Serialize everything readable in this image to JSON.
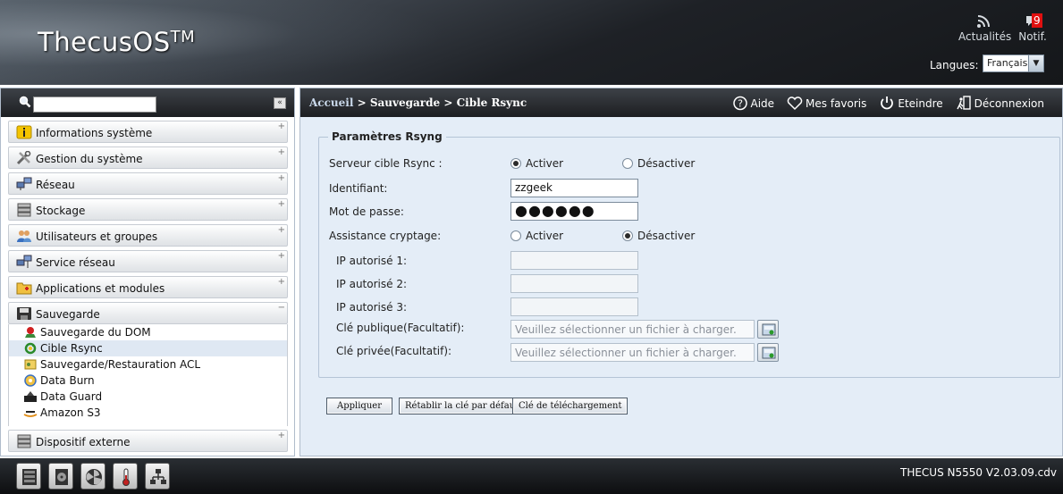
{
  "header": {
    "logo": "ThecusOS",
    "logo_tm": "TM",
    "news_label": "Actualités",
    "notif_label": "Notif.",
    "notif_count": "9",
    "language_label": "Langues:",
    "language_value": "Français"
  },
  "sidebar": {
    "search_value": "",
    "collapse_glyph": "«",
    "items": [
      {
        "label": "Informations système",
        "icon": "info-icon",
        "toggle": "+"
      },
      {
        "label": "Gestion du système",
        "icon": "tools-icon",
        "toggle": "+"
      },
      {
        "label": "Réseau",
        "icon": "network-icon",
        "toggle": "+"
      },
      {
        "label": "Stockage",
        "icon": "storage-icon",
        "toggle": "+"
      },
      {
        "label": "Utilisateurs et groupes",
        "icon": "users-icon",
        "toggle": "+"
      },
      {
        "label": "Service réseau",
        "icon": "network-service-icon",
        "toggle": "+"
      },
      {
        "label": "Applications et modules",
        "icon": "apps-icon",
        "toggle": "+"
      },
      {
        "label": "Sauvegarde",
        "icon": "backup-icon",
        "toggle": "−"
      },
      {
        "label": "Dispositif externe",
        "icon": "external-device-icon",
        "toggle": "+"
      }
    ],
    "backup_sub": [
      {
        "label": "Sauvegarde du DOM",
        "icon": "dom-backup-icon"
      },
      {
        "label": "Cible Rsync",
        "icon": "rsync-target-icon"
      },
      {
        "label": "Sauvegarde/Restauration ACL",
        "icon": "acl-icon"
      },
      {
        "label": "Data Burn",
        "icon": "disc-icon"
      },
      {
        "label": "Data Guard",
        "icon": "data-guard-icon"
      },
      {
        "label": "Amazon S3",
        "icon": "amazon-s3-icon"
      }
    ]
  },
  "topbar": {
    "crumb_home": "Accueil",
    "crumb_sep": ">",
    "crumb_section": "Sauvegarde",
    "crumb_page": "Cible Rsync",
    "help": "Aide",
    "favorites": "Mes favoris",
    "shutdown": "Eteindre",
    "logout": "Déconnexion"
  },
  "form": {
    "legend": "Paramètres Rsyng",
    "server_label": "Serveur cible Rsync :",
    "server_on": "Activer",
    "server_off": "Désactiver",
    "id_label": "Identifiant:",
    "id_value": "zzgeek",
    "pw_label": "Mot de passe:",
    "pw_value": "●●●●●●",
    "crypto_label": "Assistance cryptage:",
    "crypto_on": "Activer",
    "crypto_off": "Désactiver",
    "ip1_label": "IP autorisé 1:",
    "ip2_label": "IP autorisé 2:",
    "ip3_label": "IP autorisé 3:",
    "pub_key_label": "Clé publique(Facultatif):",
    "priv_key_label": "Clé privée(Facultatif):",
    "file_placeholder": "Veuillez sélectionner un fichier à charger.",
    "apply": "Appliquer",
    "reset_key": "Rétablir la clé par défaut",
    "download_key": "Clé de téléchargement"
  },
  "footer": {
    "version": "THECUS N5550 V2.03.09.cdv"
  }
}
